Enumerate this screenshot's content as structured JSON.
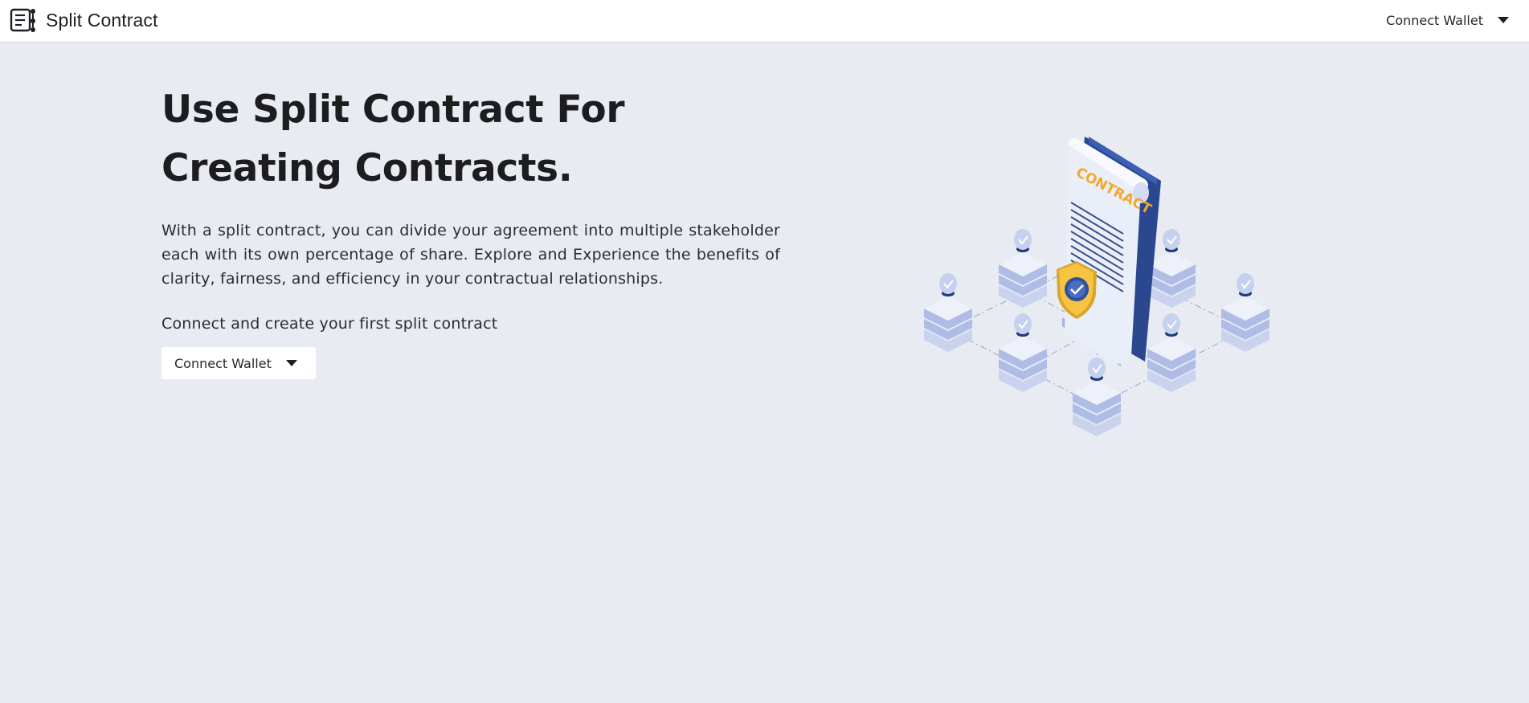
{
  "header": {
    "brand_name": "Split Contract",
    "brand_icon": "contract-list-icon",
    "wallet_label": "Connect Wallet",
    "wallet_icon": "caret-down-icon"
  },
  "hero": {
    "title": "Use Split Contract For Creating Contracts.",
    "description": "With a split contract, you can divide your agreement into multiple stakeholder each with its own percentage of share. Explore and Experience the benefits of clarity, fairness, and efficiency in your contractual relationships.",
    "cta_text": "Connect and create your first split contract",
    "wallet_label": "Connect Wallet",
    "wallet_icon": "caret-down-icon"
  },
  "illustration": {
    "contract_label": "CONTRACT",
    "name": "contract-network-illustration"
  },
  "colors": {
    "background": "#e8ebf2",
    "topbar": "#ffffff",
    "document_blue": "#2f4f9f",
    "document_face": "#e9eef9",
    "label_orange": "#f3a926",
    "shield_yellow": "#f6c343",
    "node_blue": "#8ea3da"
  }
}
